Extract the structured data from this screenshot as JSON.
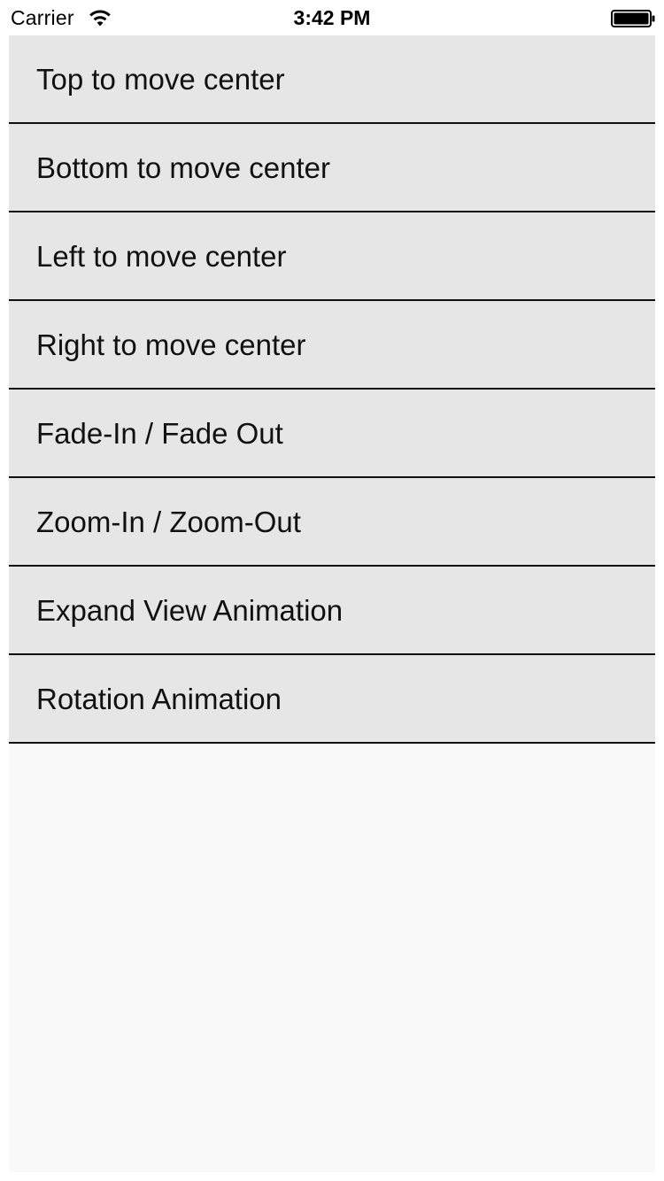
{
  "status_bar": {
    "carrier": "Carrier",
    "time": "3:42 PM",
    "wifi_icon": "wifi-icon",
    "battery_icon": "battery-full-icon"
  },
  "list": {
    "items": [
      {
        "label": "Top to move center"
      },
      {
        "label": "Bottom to move center"
      },
      {
        "label": "Left to move center"
      },
      {
        "label": "Right to move center"
      },
      {
        "label": "Fade-In / Fade Out"
      },
      {
        "label": "Zoom-In / Zoom-Out"
      },
      {
        "label": "Expand View Animation"
      },
      {
        "label": "Rotation Animation"
      }
    ]
  },
  "colors": {
    "row_background": "#e6e6e6",
    "row_separator": "#111111",
    "content_background": "#f9f9f9",
    "text": "#111111"
  }
}
